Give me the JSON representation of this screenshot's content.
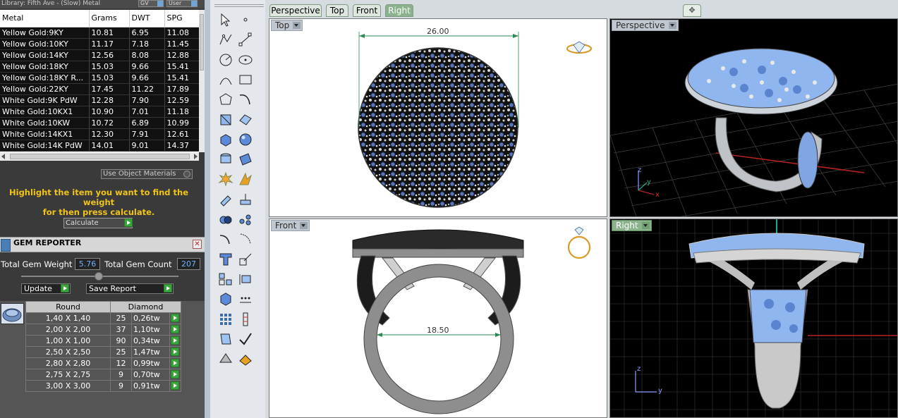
{
  "library_header": {
    "text": "Library: Fifth Ave - (Slow) Metal",
    "select1": "GV",
    "select2": "User"
  },
  "metal_table": {
    "columns": [
      "Metal",
      "Grams",
      "DWT",
      "SPG"
    ],
    "rows": [
      [
        "Yellow Gold:9KY",
        "10.81",
        "6.95",
        "11.08"
      ],
      [
        "Yellow Gold:10KY",
        "11.17",
        "7.18",
        "11.45"
      ],
      [
        "Yellow Gold:14KY",
        "12.56",
        "8.08",
        "12.88"
      ],
      [
        "Yellow Gold:18KY",
        "15.03",
        "9.66",
        "15.41"
      ],
      [
        "Yellow Gold:18KY R...",
        "15.03",
        "9.66",
        "15.41"
      ],
      [
        "Yellow Gold:22KY",
        "17.45",
        "11.22",
        "17.89"
      ],
      [
        "White Gold:9K PdW",
        "12.28",
        "7.90",
        "12.59"
      ],
      [
        "White Gold:10KX1",
        "10.90",
        "7.01",
        "11.18"
      ],
      [
        "White Gold:10KW",
        "10.72",
        "6.89",
        "10.99"
      ],
      [
        "White Gold:14KX1",
        "12.30",
        "7.91",
        "12.61"
      ],
      [
        "White Gold:14K PdW",
        "14.01",
        "9.01",
        "14.37"
      ]
    ]
  },
  "use_object_materials": "Use Object Materials",
  "highlight_message_line1": "Highlight the item you want to find the weight",
  "highlight_message_line2": "for then press calculate.",
  "calculate_label": "Calculate",
  "gem_reporter": {
    "title": "GEM REPORTER",
    "total_weight_label": "Total Gem Weight",
    "total_weight_value": "5.76",
    "total_count_label": "Total Gem Count",
    "total_count_value": "207",
    "update_label": "Update",
    "save_report_label": "Save Report",
    "table_headers": [
      "Round",
      "Diamond"
    ],
    "rows": [
      [
        "1,40 X 1,40",
        "25",
        "0,26tw"
      ],
      [
        "2,00 X 2,00",
        "37",
        "1,10tw"
      ],
      [
        "1,00 X 1,00",
        "90",
        "0,34tw"
      ],
      [
        "2,50 X 2,50",
        "25",
        "1,47tw"
      ],
      [
        "2,80 X 2,80",
        "12",
        "0,99tw"
      ],
      [
        "2,75 X 2,75",
        "9",
        "0,70tw"
      ],
      [
        "3,00 X 3,00",
        "9",
        "0,91tw"
      ]
    ]
  },
  "view_tabs": [
    {
      "label": "Perspective",
      "active": false
    },
    {
      "label": "Top",
      "active": false
    },
    {
      "label": "Front",
      "active": false
    },
    {
      "label": "Right",
      "active": true
    }
  ],
  "viewports": {
    "top": {
      "label": "Top",
      "dimension": "26.00"
    },
    "perspective": {
      "label": "Perspective"
    },
    "front": {
      "label": "Front",
      "dimension": "18.50"
    },
    "right": {
      "label": "Right"
    }
  },
  "axis_labels": {
    "x": "x",
    "y": "y",
    "z": "z"
  },
  "colors": {
    "accent_green": "#8ab38c",
    "gem_blue": "#7fb0f0",
    "highlight_yellow": "#f0c419",
    "dark_viewport": "#000000"
  }
}
